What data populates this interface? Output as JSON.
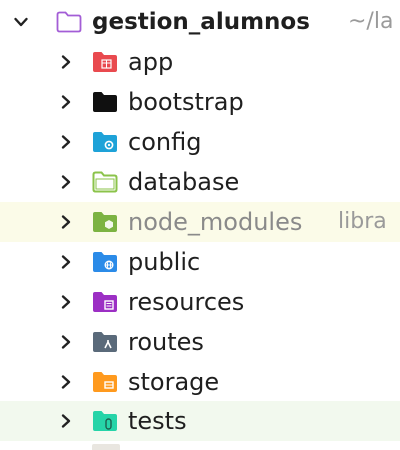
{
  "project": {
    "name": "gestion_alumnos",
    "path": "~/la"
  },
  "folders": [
    {
      "label": "app",
      "icon": "app-folder-icon",
      "color": "#e94a4f"
    },
    {
      "label": "bootstrap",
      "icon": "bootstrap-folder-icon",
      "color": "#101010"
    },
    {
      "label": "config",
      "icon": "config-folder-icon",
      "color": "#1ea2d8"
    },
    {
      "label": "database",
      "icon": "database-folder-icon",
      "color": "#8bc34a"
    },
    {
      "label": "node_modules",
      "suffix": "libra",
      "icon": "node-modules-folder-icon",
      "color": "#7cb342"
    },
    {
      "label": "public",
      "icon": "public-folder-icon",
      "color": "#2b8be8"
    },
    {
      "label": "resources",
      "icon": "resources-folder-icon",
      "color": "#9c2fc4"
    },
    {
      "label": "routes",
      "icon": "routes-folder-icon",
      "color": "#5a6a7a"
    },
    {
      "label": "storage",
      "icon": "storage-folder-icon",
      "color": "#ff9a1e"
    },
    {
      "label": "tests",
      "icon": "tests-folder-icon",
      "color": "#26d4a8"
    }
  ]
}
